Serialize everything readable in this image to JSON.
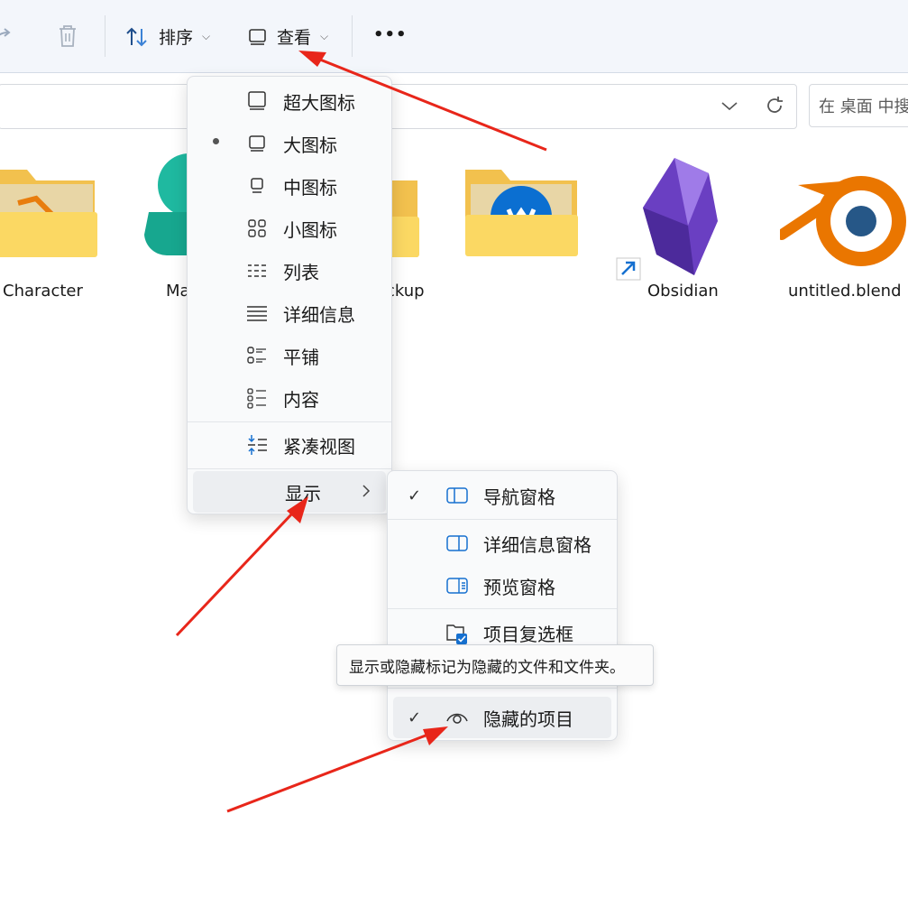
{
  "toolbar": {
    "sort_label": "排序",
    "view_label": "查看",
    "more_label": "•••"
  },
  "search": {
    "placeholder": "在 桌面 中搜"
  },
  "files": [
    {
      "label": "Character"
    },
    {
      "label": "Ma"
    },
    {
      "label": "ckup"
    },
    {
      "label": "Obsidian"
    },
    {
      "label": "untitled.blend"
    }
  ],
  "view_menu": {
    "items": [
      {
        "label": "超大图标",
        "icon": "extra-large-icons-icon"
      },
      {
        "label": "大图标",
        "icon": "large-icons-icon",
        "selected": true
      },
      {
        "label": "中图标",
        "icon": "medium-icons-icon"
      },
      {
        "label": "小图标",
        "icon": "small-icons-icon"
      },
      {
        "label": "列表",
        "icon": "list-icon"
      },
      {
        "label": "详细信息",
        "icon": "details-icon"
      },
      {
        "label": "平铺",
        "icon": "tiles-icon"
      },
      {
        "label": "内容",
        "icon": "content-icon"
      },
      {
        "label": "紧凑视图",
        "icon": "compact-view-icon"
      },
      {
        "label": "显示",
        "icon": "chevron-right-icon"
      }
    ]
  },
  "show_submenu": {
    "items": [
      {
        "label": "导航窗格",
        "checked": true,
        "icon": "navigation-pane-icon"
      },
      {
        "label": "详细信息窗格",
        "checked": false,
        "icon": "details-pane-icon"
      },
      {
        "label": "预览窗格",
        "checked": false,
        "icon": "preview-pane-icon"
      },
      {
        "label": "项目复选框",
        "checked": true,
        "icon": "item-checkbox-icon"
      },
      {
        "label": "隐藏的项目",
        "checked": true,
        "icon": "eye-icon"
      }
    ],
    "check_mark": "✓"
  },
  "tooltip": {
    "text": "显示或隐藏标记为隐藏的文件和文件夹。"
  },
  "colors": {
    "accent": "#0067c0",
    "annotation": "#e8261a",
    "folder": "#f8cf55"
  }
}
